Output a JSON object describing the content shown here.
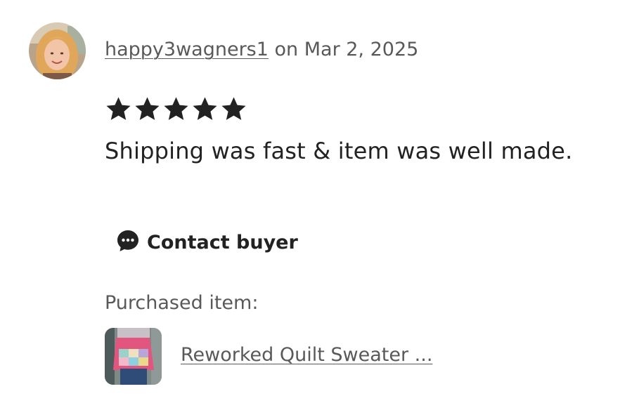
{
  "review": {
    "username": "happy3wagners1",
    "date_text": " on Mar 2, 2025",
    "rating": 5,
    "stars_icon": "star-icon",
    "text": "Shipping was fast & item was well made."
  },
  "actions": {
    "contact_label": "Contact buyer",
    "contact_icon": "chat-bubble-icon"
  },
  "purchase": {
    "label": "Purchased item:",
    "item_title": "Reworked Quilt Sweater ..."
  },
  "colors": {
    "text_primary": "#222222",
    "text_secondary": "#595959"
  }
}
